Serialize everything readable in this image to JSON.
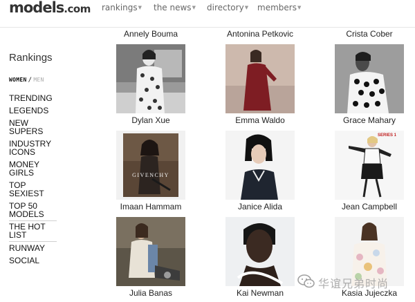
{
  "header": {
    "logo": "models",
    "logo_domain": ".com",
    "nav": [
      {
        "label": "rankings"
      },
      {
        "label": "the news"
      },
      {
        "label": "directory"
      },
      {
        "label": "members"
      }
    ]
  },
  "sidebar": {
    "title": "Rankings",
    "women": "WOMEN",
    "slash": "/",
    "men": "MEN",
    "categories": [
      {
        "lines": [
          "TRENDING"
        ]
      },
      {
        "lines": [
          "LEGENDS"
        ]
      },
      {
        "lines": [
          "NEW",
          "SUPERS"
        ]
      },
      {
        "lines": [
          "INDUSTRY",
          "ICONS"
        ]
      },
      {
        "lines": [
          "MONEY",
          "GIRLS"
        ]
      },
      {
        "lines": [
          "TOP",
          "SEXIEST"
        ]
      },
      {
        "lines": [
          "TOP 50",
          "MODELS"
        ]
      },
      {
        "lines": [
          "THE HOT",
          "LIST"
        ]
      },
      {
        "lines": [
          "RUNWAY"
        ]
      },
      {
        "lines": [
          "SOCIAL"
        ]
      }
    ]
  },
  "grid": {
    "top_names": [
      "Annely Bouma",
      "Antonina Petkovic",
      "Crista Cober"
    ],
    "rows": [
      [
        {
          "name": "Dylan Xue",
          "photo": "bw-floral-portrait"
        },
        {
          "name": "Emma Waldo",
          "photo": "red-dress-portrait"
        },
        {
          "name": "Grace Mahary",
          "photo": "polka-dot-portrait"
        }
      ],
      [
        {
          "name": "Imaan Hammam",
          "photo": "givenchy-ad",
          "caption": "GIVENCHY"
        },
        {
          "name": "Janice Alida",
          "photo": "black-bob-portrait"
        },
        {
          "name": "Jean Campbell",
          "photo": "series-editorial",
          "caption": "SERIES 1"
        }
      ],
      [
        {
          "name": "Julia Banas",
          "photo": "seated-editorial"
        },
        {
          "name": "Kai Newman",
          "photo": "beauty-closeup"
        },
        {
          "name": "Kasia Jujeczka",
          "photo": "floral-top-portrait"
        }
      ]
    ]
  },
  "watermark": {
    "text": "华谊兄弟时尚",
    "icon": "wechat-icon"
  },
  "colors": {
    "text": "#222222",
    "nav": "#666666",
    "muted": "#aaaaaa",
    "rule": "#e6e6e6"
  }
}
